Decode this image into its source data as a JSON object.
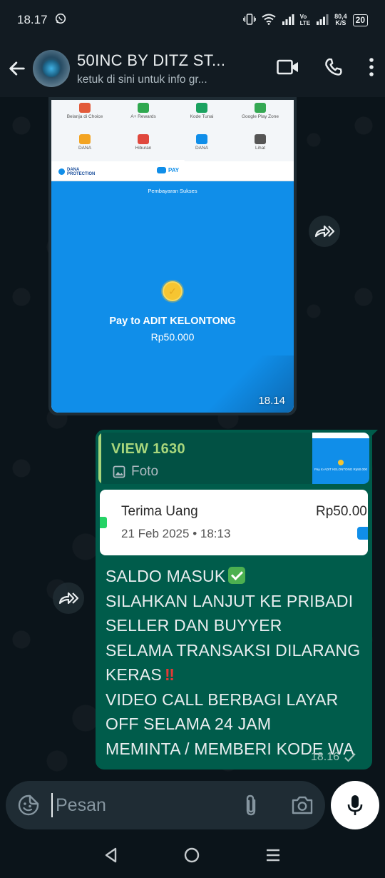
{
  "status_bar": {
    "time": "18.17",
    "net_speed_value": "80,4",
    "net_speed_unit": "K/S",
    "volte_top": "Vo",
    "volte_bottom": "LTE",
    "battery": "20"
  },
  "header": {
    "title": "50INC BY DITZ ST...",
    "subtitle": "ketuk di sini untuk info gr..."
  },
  "image_message": {
    "screenshot": {
      "grid": [
        {
          "label": "Belanja di Choice",
          "color": "#e25a3a"
        },
        {
          "label": "A+ Rewards",
          "color": "#2fa84f"
        },
        {
          "label": "Kode Tunai",
          "color": "#1aa260"
        },
        {
          "label": "Google Play Zone",
          "color": "#34a853"
        },
        {
          "label": "DANA",
          "color": "#f3a422"
        },
        {
          "label": "Hiburan",
          "color": "#e0483e"
        },
        {
          "label": "DANA",
          "color": "#108ee9"
        },
        {
          "label": "Lihat",
          "color": "#555555"
        }
      ],
      "protection_label": "DANA PROTECTION",
      "pay_label": "PAY",
      "status": "Pembayaran Sukses",
      "pay_to": "Pay to ADIT KELONTONG",
      "amount": "Rp50.000"
    },
    "time": "18.14"
  },
  "reply_message": {
    "quote": {
      "name": "VIEW 1630",
      "type": "Foto",
      "thumb_text": "Pay to ADIT KELONTONG Rp50.000"
    },
    "notification": {
      "title": "Terima Uang",
      "amount": "Rp50.00",
      "date": "21 Feb 2025 • 18:13"
    },
    "lines": [
      "SALDO MASUK",
      "SILAHKAN LANJUT KE PRIBADI",
      "SELLER DAN BUYYER",
      "SELAMA TRANSAKSI DILARANG",
      "KERAS",
      "VIDEO CALL BERBAGI LAYAR",
      "OFF SELAMA 24 JAM",
      "MEMINTA / MEMBERI KODE WA"
    ],
    "emoji_bang": "‼",
    "time": "18.16"
  },
  "input": {
    "placeholder": "Pesan"
  },
  "colors": {
    "header_bg": "#121b22",
    "chat_bg": "#0b141a",
    "outgoing_bubble": "#005c4b",
    "incoming_bubble": "#1f2c34",
    "quote_accent": "#a8d67c",
    "dana_blue": "#108ee9"
  },
  "icons": {
    "back": "arrow-left-icon",
    "video": "video-camera-icon",
    "call": "phone-icon",
    "menu": "more-vert-icon",
    "forward": "forward-icon",
    "emoji": "sticker-icon",
    "attach": "paperclip-icon",
    "camera": "camera-icon",
    "mic": "mic-icon"
  }
}
